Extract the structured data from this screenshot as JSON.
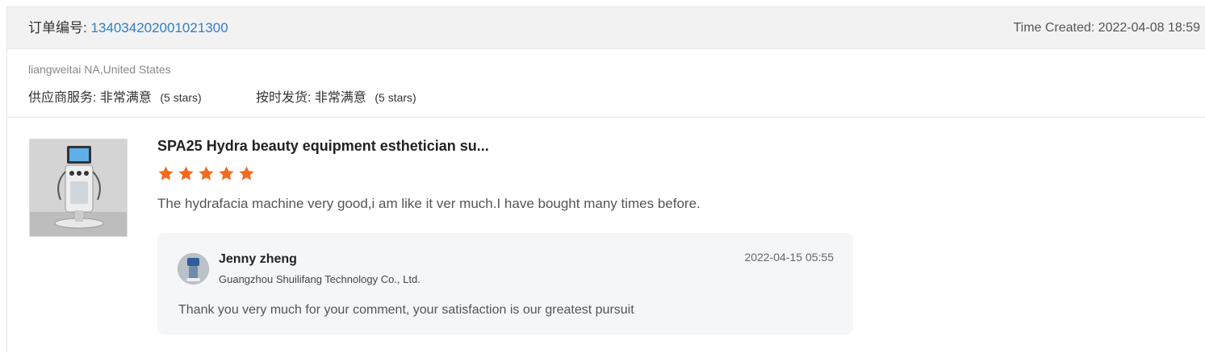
{
  "order": {
    "label": "订单编号:",
    "number": "134034202001021300",
    "time_created": "Time Created: 2022-04-08 18:59"
  },
  "buyer": {
    "name_location": "liangweitai NA,United States",
    "supplier_service": {
      "label": "供应商服务:",
      "value": "非常满意",
      "stars_text": "(5 stars)"
    },
    "on_time_shipping": {
      "label": "按时发货:",
      "value": "非常满意",
      "stars_text": "(5 stars)"
    }
  },
  "review": {
    "product_icon": "product-thumbnail-icon",
    "product_title": "SPA25 Hydra beauty equipment esthetician su...",
    "rating": 5,
    "rating_max": 5,
    "star_color": "#f46a1d",
    "text": "The hydrafacia machine very good,i am like it ver much.I have bought many times before."
  },
  "reply": {
    "avatar_icon": "avatar-icon",
    "name": "Jenny zheng",
    "company": "Guangzhou Shuilifang Technology Co., Ltd.",
    "date": "2022-04-15 05:55",
    "text": "Thank you very much for your comment, your satisfaction is our greatest pursuit"
  },
  "colors": {
    "link": "#2f7fc4",
    "header_bg": "#f2f2f2",
    "reply_bg": "#f5f6f8"
  }
}
